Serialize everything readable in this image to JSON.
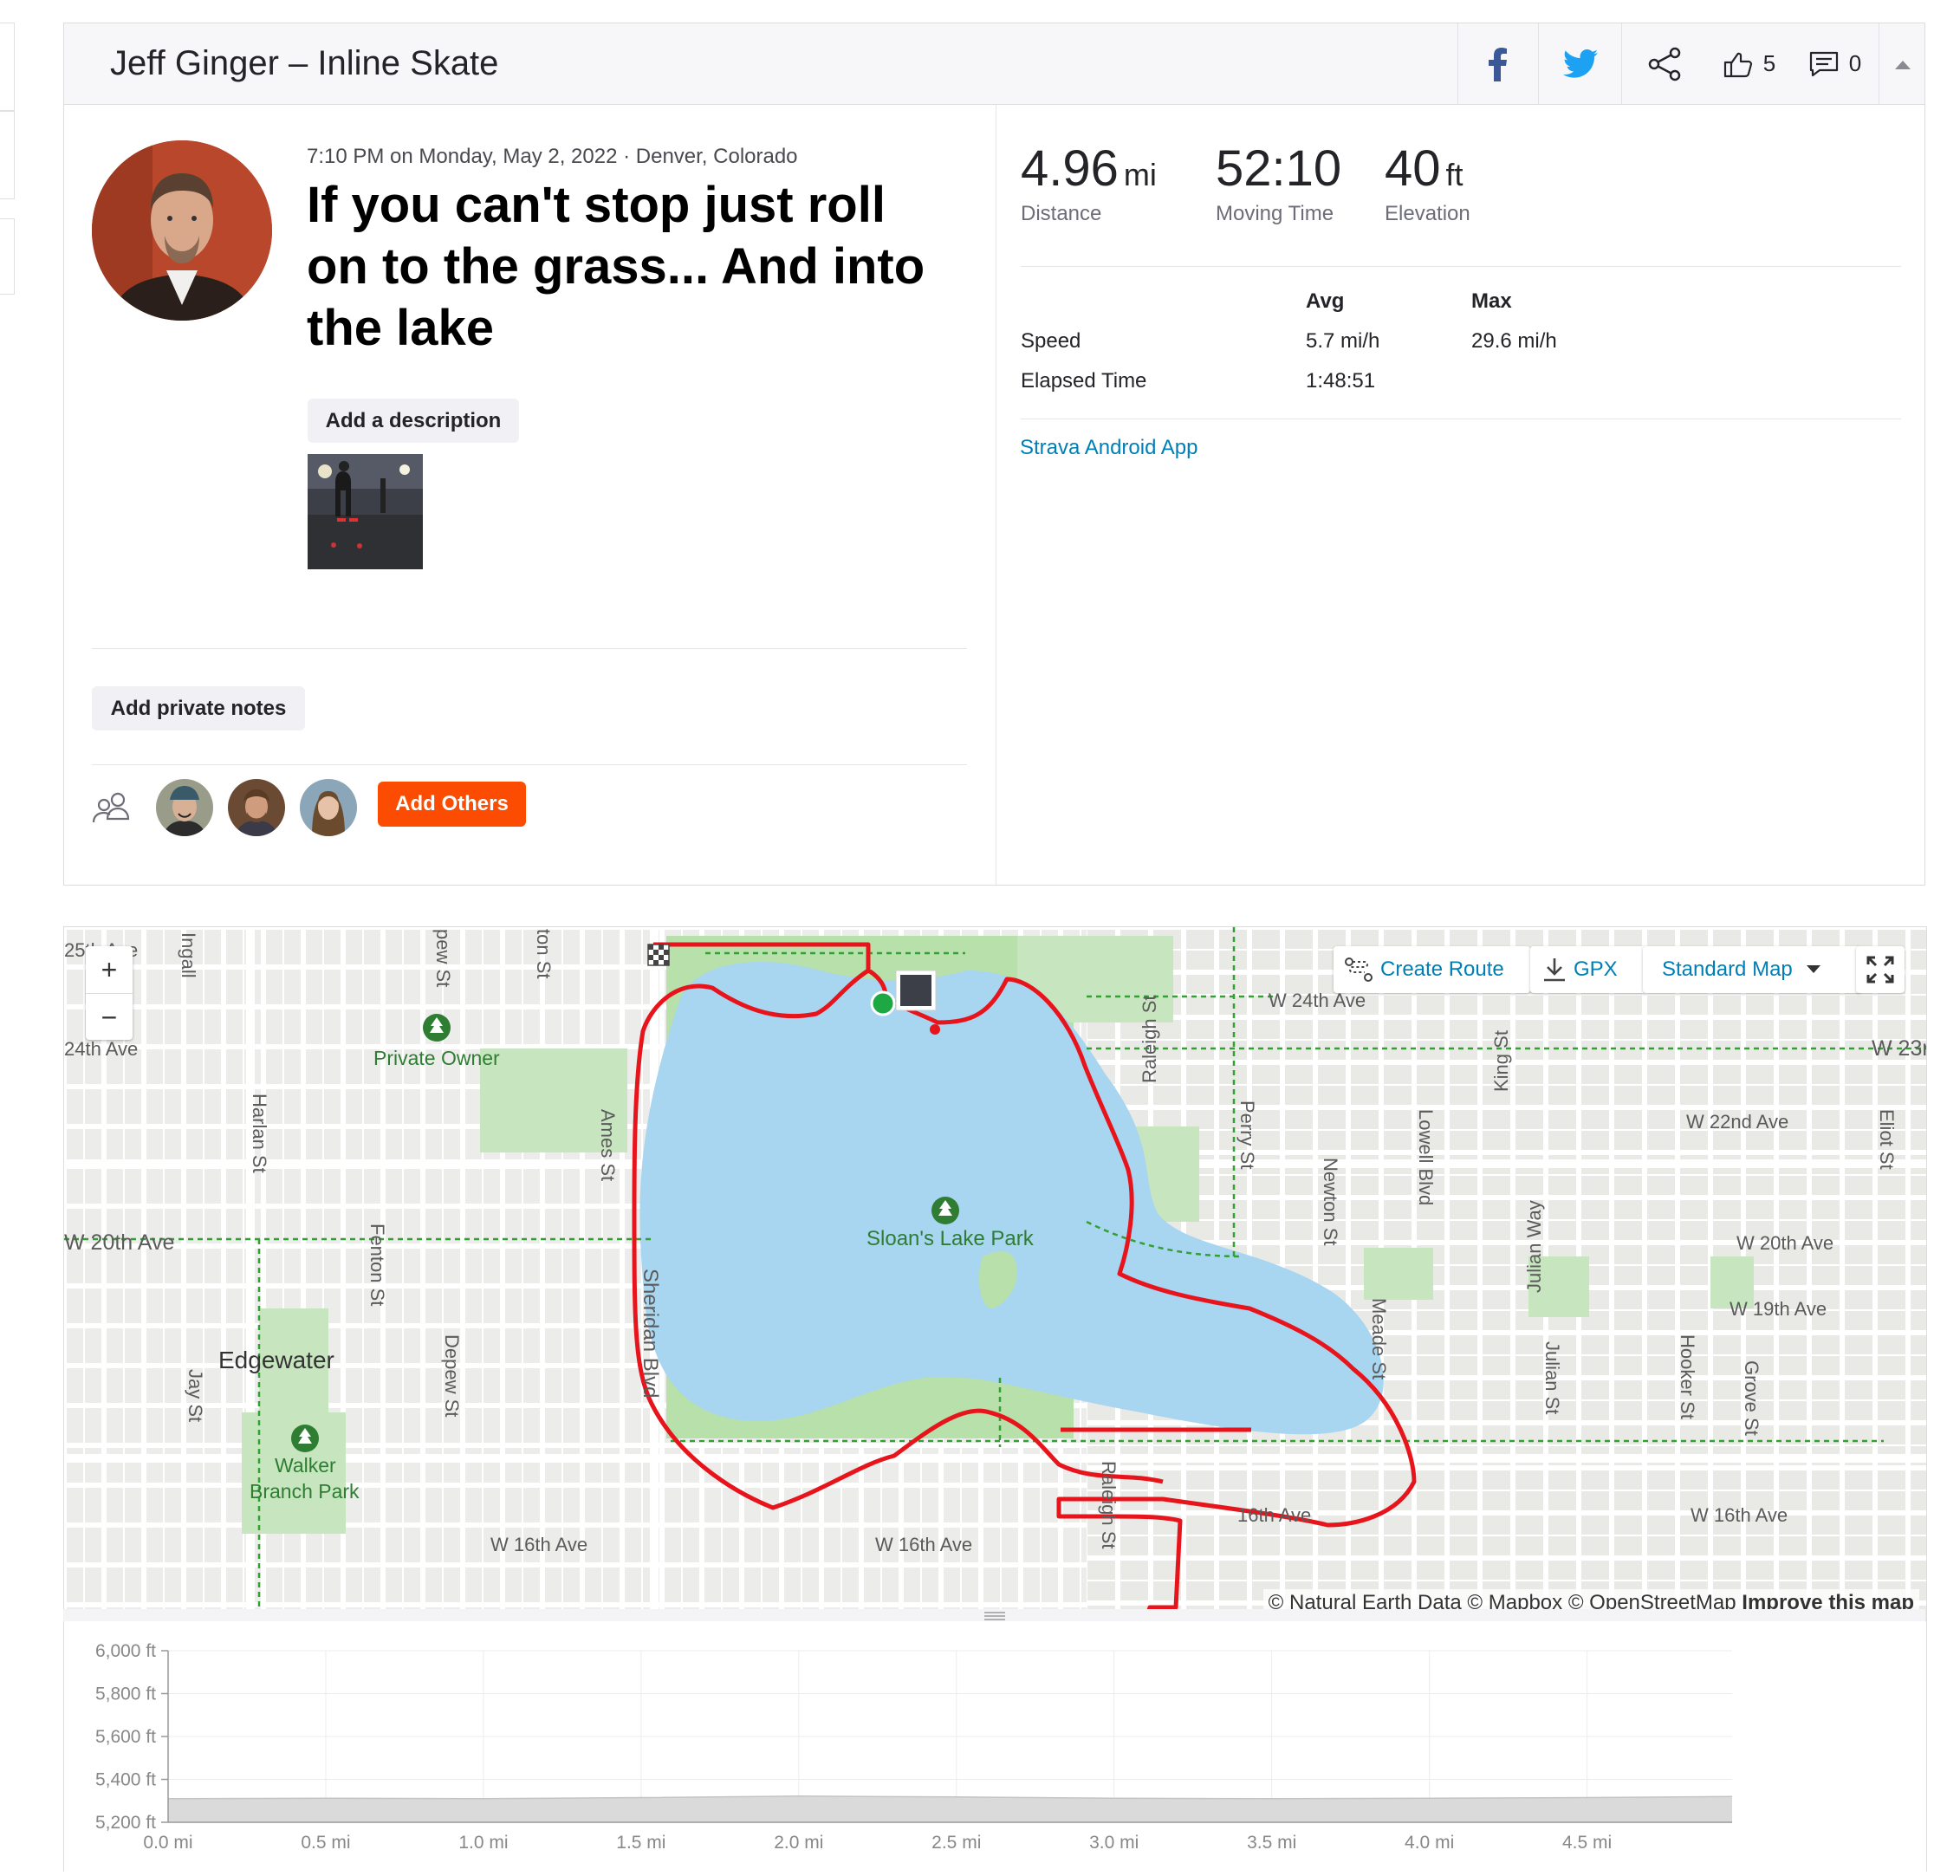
{
  "header": {
    "title": "Jeff Ginger – Inline Skate",
    "kudos_count": "5",
    "comments_count": "0"
  },
  "activity": {
    "meta": "7:10 PM on Monday, May 2, 2022 · Denver, Colorado",
    "title": "If you can't stop just roll on to the grass... And into the lake",
    "add_description": "Add a description",
    "add_private_notes": "Add private notes",
    "add_others": "Add Others"
  },
  "stats": {
    "distance": {
      "value": "4.96",
      "unit": "mi",
      "label": "Distance"
    },
    "moving_time": {
      "value": "52:10",
      "label": "Moving Time"
    },
    "elevation": {
      "value": "40",
      "unit": "ft",
      "label": "Elevation"
    },
    "table": {
      "col_avg": "Avg",
      "col_max": "Max",
      "speed_label": "Speed",
      "speed_avg": "5.7 mi/h",
      "speed_max": "29.6 mi/h",
      "elapsed_label": "Elapsed Time",
      "elapsed_avg": "1:48:51"
    },
    "device": "Strava Android App"
  },
  "map": {
    "create_route": "Create Route",
    "gpx": "GPX",
    "map_type": "Standard Map",
    "zoom_in": "+",
    "zoom_out": "−",
    "attribution": "© Natural Earth Data © Mapbox © OpenStreetMap",
    "improve": "Improve this map",
    "labels": {
      "w25": "25th Ave",
      "w24": "24th Ave",
      "ingalls": "Ingall",
      "depew_top": "pew St",
      "ston_top": "ton St",
      "private_owner": "Private Owner",
      "harlan": "Harlan St",
      "ames": "Ames St",
      "w20_left": "W 20th Ave",
      "fenton": "Fenton St",
      "edgewater": "Edgewater",
      "depew": "Depew St",
      "jay": "Jay St",
      "walker1": "Walker",
      "walker2": "Branch Park",
      "w16_a": "W 16th Ave",
      "w16_b": "W 16th Ave",
      "w16_c": "16th Ave",
      "w16_d": "W 16th Ave",
      "sheridan": "Sheridan Blvd",
      "sloans": "Sloan's Lake Park",
      "raleigh": "Raleigh St",
      "raleigh_bottom": "Raleigh St",
      "perry": "Perry St",
      "w24_right": "W 24th Ave",
      "newton": "Newton St",
      "lowell": "Lowell Blvd",
      "king": "King St",
      "julian_way": "Julian Way",
      "meade": "Meade St",
      "julian": "Julian St",
      "w23": "W 23r",
      "w22": "W 22nd Ave",
      "w20_right": "W 20th Ave",
      "w19": "W 19th Ave",
      "hooker": "Hooker St",
      "grove": "Grove St",
      "eliot": "Eliot St"
    }
  },
  "chart_data": {
    "type": "area",
    "title": "",
    "xlabel": "",
    "ylabel": "",
    "x_ticks": [
      "0.0 mi",
      "0.5 mi",
      "1.0 mi",
      "1.5 mi",
      "2.0 mi",
      "2.5 mi",
      "3.0 mi",
      "3.5 mi",
      "4.0 mi",
      "4.5 mi"
    ],
    "y_ticks": [
      "6,000 ft",
      "5,800 ft",
      "5,600 ft",
      "5,400 ft",
      "5,200 ft"
    ],
    "xlim": [
      0,
      4.96
    ],
    "ylim": [
      5200,
      6000
    ],
    "x": [
      0,
      0.5,
      1.0,
      1.5,
      2.0,
      2.5,
      3.0,
      3.5,
      4.0,
      4.5,
      4.96
    ],
    "series": [
      {
        "values": [
          5310,
          5312,
          5310,
          5315,
          5322,
          5318,
          5312,
          5310,
          5312,
          5315,
          5320
        ]
      }
    ],
    "grid": true,
    "colors": {
      "fill": "#dadada",
      "line": "#c4c4c4"
    }
  }
}
